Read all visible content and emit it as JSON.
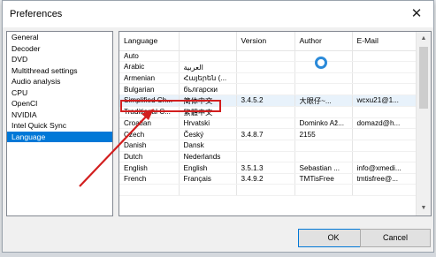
{
  "dialog": {
    "title": "Preferences",
    "close_glyph": "✕"
  },
  "categories": [
    {
      "label": "General"
    },
    {
      "label": "Decoder"
    },
    {
      "label": "DVD"
    },
    {
      "label": "Multithread settings"
    },
    {
      "label": "Audio analysis"
    },
    {
      "label": "CPU"
    },
    {
      "label": "OpenCl"
    },
    {
      "label": "NVIDIA"
    },
    {
      "label": "Intel Quick Sync"
    },
    {
      "label": "Language"
    }
  ],
  "selected_category": "Language",
  "table": {
    "columns": [
      "Language",
      "Version",
      "Author",
      "E-Mail"
    ],
    "rows": [
      [
        "Auto",
        "",
        "",
        "",
        ""
      ],
      [
        "Arabic",
        "العربية",
        "",
        "",
        ""
      ],
      [
        "Armenian",
        "Հայերեն (...",
        "",
        "",
        ""
      ],
      [
        "Bulgarian",
        "български",
        "",
        "",
        ""
      ],
      [
        "Simplified Ch...",
        "简体中文",
        "3.4.5.2",
        "大眼仔~...",
        "wcxu21@1..."
      ],
      [
        "Traditional C...",
        "繁體中文",
        "",
        "",
        ""
      ],
      [
        "Croatian",
        "Hrvatski",
        "",
        "Dominko Až...",
        "domazd@h..."
      ],
      [
        "Czech",
        "Český",
        "3.4.8.7",
        "2155",
        ""
      ],
      [
        "Danish",
        "Dansk",
        "",
        "",
        ""
      ],
      [
        "Dutch",
        "Nederlands",
        "",
        "",
        ""
      ],
      [
        "English",
        "English",
        "3.5.1.3",
        "Sebastian ...",
        "info@xmedi..."
      ],
      [
        "French",
        "Français",
        "3.4.9.2",
        "TMTisFree",
        "tmtisfree@..."
      ],
      [
        "",
        "",
        "",
        "",
        ""
      ]
    ],
    "current_row": 4
  },
  "buttons": {
    "ok": "OK",
    "cancel": "Cancel"
  },
  "scrollbar": {
    "up_glyph": "▲",
    "down_glyph": "▼"
  },
  "colors": {
    "selection": "#0078d7",
    "annotation": "#d21e1e"
  }
}
